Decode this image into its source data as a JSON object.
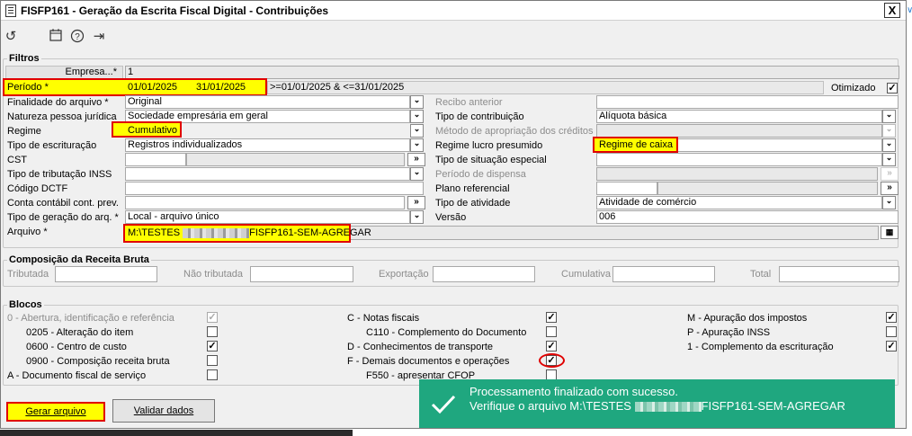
{
  "window": {
    "title": "FISFP161 - Geração da Escrita Fiscal Digital - Contribuições",
    "close": "X"
  },
  "toolbar": {
    "icons": [
      "refresh-icon",
      "calendar-icon",
      "help-icon",
      "exit-icon"
    ]
  },
  "filtros": {
    "title": "Filtros",
    "empresa": {
      "label": "Empresa...*",
      "value": "1"
    },
    "periodo": {
      "label": "Período *",
      "start": "01/01/2025",
      "end": "31/01/2025",
      "expr": ">=01/01/2025 & <=31/01/2025"
    },
    "otimizado": {
      "label": "Otimizado",
      "checked": true
    },
    "left": [
      {
        "label": "Finalidade do arquivo *",
        "value": "Original"
      },
      {
        "label": "Natureza pessoa jurídica",
        "value": "Sociedade empresária em geral"
      },
      {
        "label": "Regime",
        "value": "Cumulativo"
      },
      {
        "label": "Tipo de escrituração",
        "value": "Registros individualizados"
      },
      {
        "label": "CST",
        "value": ""
      },
      {
        "label": "Tipo de tributação INSS",
        "value": ""
      },
      {
        "label": "Código DCTF",
        "value": ""
      },
      {
        "label": "Conta contábil cont. prev.",
        "value": ""
      },
      {
        "label": "Tipo de geração do arq. *",
        "value": "Local - arquivo único"
      }
    ],
    "right": [
      {
        "label": "Recibo anterior",
        "value": ""
      },
      {
        "label": "Tipo de contribuição",
        "value": "Alíquota básica"
      },
      {
        "label": "Método de apropriação dos créditos",
        "value": ""
      },
      {
        "label": "Regime lucro presumido",
        "value": "Regime de caixa"
      },
      {
        "label": "Tipo de situação especial",
        "value": ""
      },
      {
        "label": "Período de dispensa",
        "value": ""
      },
      {
        "label": "Plano referencial",
        "value": ""
      },
      {
        "label": "Tipo de atividade",
        "value": "Atividade de comércio"
      },
      {
        "label": "Versão",
        "value": "006"
      }
    ],
    "arquivo": {
      "label": "Arquivo *",
      "prefix": "M:\\TESTES",
      "suffix": "FISFP161-SEM-AGREGAR"
    }
  },
  "composicao": {
    "title": "Composição da Receita Bruta",
    "fields": [
      {
        "label": "Tributada",
        "value": ""
      },
      {
        "label": "Não tributada",
        "value": ""
      },
      {
        "label": "Exportação",
        "value": ""
      },
      {
        "label": "Cumulativa",
        "value": ""
      },
      {
        "label": "Total",
        "value": ""
      }
    ]
  },
  "blocos": {
    "title": "Blocos",
    "col1": [
      {
        "label": "0 - Abertura, identificação e referência",
        "checked": true,
        "disabled": true
      },
      {
        "label": "0205 - Alteração do item",
        "checked": false
      },
      {
        "label": "0600 - Centro de custo",
        "checked": true
      },
      {
        "label": "0900 - Composição receita bruta",
        "checked": false
      },
      {
        "label": "A - Documento fiscal de serviço",
        "checked": false
      }
    ],
    "col2": [
      {
        "label": "C - Notas fiscais",
        "checked": true
      },
      {
        "label": "C110 - Complemento do Documento",
        "checked": false
      },
      {
        "label": "D - Conhecimentos de transporte",
        "checked": true
      },
      {
        "label": "F - Demais documentos e operações",
        "checked": true
      },
      {
        "label": "F550 - apresentar CFOP",
        "checked": false
      }
    ],
    "col3": [
      {
        "label": "M - Apuração dos impostos",
        "checked": true
      },
      {
        "label": "P - Apuração INSS",
        "checked": false
      },
      {
        "label": "1 - Complemento da escrituração",
        "checked": true
      }
    ]
  },
  "buttons": {
    "gerar": "Gerar arquivo",
    "validar": "Validar dados"
  },
  "toast": {
    "line1": "Processamento finalizado com sucesso.",
    "line2_prefix": "Verifique o arquivo M:\\TESTES",
    "line2_suffix": "FISFP161-SEM-AGREGAR"
  },
  "colors": {
    "highlight": "#ffff00",
    "highlight_border": "#e00000",
    "toast": "#1fa77f"
  }
}
